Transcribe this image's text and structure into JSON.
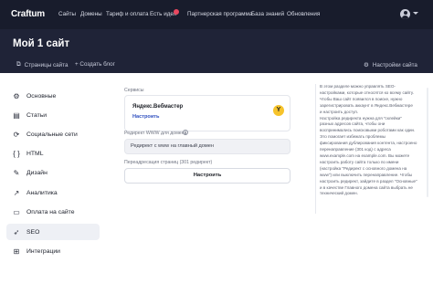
{
  "header": {
    "logo": "Craftum",
    "nav": [
      "Сайты",
      "Домены",
      "Тариф и оплата",
      "Есть идея",
      "Партнерская программа",
      "База знаний",
      "Обновления"
    ]
  },
  "hero": {
    "title": "Мой 1 сайт",
    "actions": {
      "pages": "Страницы сайта",
      "create_blog": "+ Создать блог",
      "settings": "Настройки сайта"
    }
  },
  "sidebar": {
    "items": [
      {
        "label": "Основные",
        "icon": "gear-icon",
        "glyph": "⚙"
      },
      {
        "label": "Статьи",
        "icon": "document-icon",
        "glyph": "▤"
      },
      {
        "label": "Социальные сети",
        "icon": "share-icon",
        "glyph": "⟳"
      },
      {
        "label": "HTML",
        "icon": "code-icon",
        "glyph": "{ }"
      },
      {
        "label": "Дизайн",
        "icon": "palette-icon",
        "glyph": "✎"
      },
      {
        "label": "Аналитика",
        "icon": "chart-icon",
        "glyph": "↗"
      },
      {
        "label": "Оплата на сайте",
        "icon": "card-icon",
        "glyph": "▭"
      },
      {
        "label": "SEO",
        "icon": "rocket-icon",
        "glyph": "➶"
      },
      {
        "label": "Интеграции",
        "icon": "grid-icon",
        "glyph": "⊞"
      }
    ],
    "active_index": 7
  },
  "main": {
    "services_label": "Сервисы",
    "yandex": {
      "title": "Яндекс.Вебмастер",
      "link": "Настроить",
      "logo_letter": "Y"
    },
    "redirect_www_label": "Редирект WWW для домена",
    "redirect_www_value": "Редирект с www на главный домен",
    "redirect_301_label": "Переадресация страниц (301 редирект)",
    "configure_button": "Настроить"
  },
  "help": {
    "lines": [
      "В этом разделе можно управлять SEO-",
      "настройками, которые относятся ко всему сайту.",
      "Чтобы Ваш сайт появился в поиске, нужно",
      "зарегистрировать аккаунт в Яндекс.Вебмастере",
      "и настроить доступ.",
      "Настройка редиректа нужна для \"склейки\"",
      "разных адресов сайта, чтобы они",
      "воспринимались поисковыми роботами как один.",
      "Это помогает избежать проблемы",
      "фиксирования дублирования контента, настроено",
      "перенаправление (301 код) с адреса",
      "www.example.com на example.com. Вы можете",
      "настроить работу сайта только по имени",
      "(настройка \"Редирект с основного домена на",
      "www\") или выключить перенаправление. Чтобы",
      "настроить редирект, зайдите в раздел \"Основные\"",
      "и в качестве Главного домена сайта выбрать не",
      "технический домен."
    ]
  }
}
